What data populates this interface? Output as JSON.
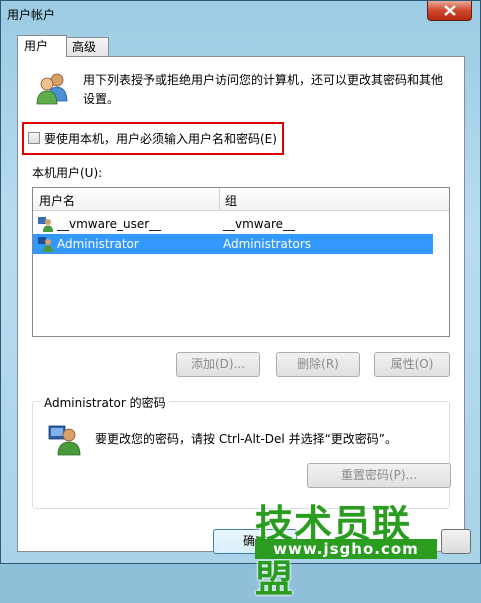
{
  "window": {
    "title": "用户帐户",
    "close_icon": "close-icon"
  },
  "tabs": [
    {
      "label": "用户",
      "active": true
    },
    {
      "label": "高级",
      "active": false
    }
  ],
  "intro": {
    "icon": "users-icon",
    "text": "用下列表授予或拒绝用户访问您的计算机，还可以更改其密码和其他设置。"
  },
  "require_login": {
    "label": "要使用本机，用户必须输入用户名和密码(E)",
    "checked": false,
    "highlight_color": "#e00000"
  },
  "users_list": {
    "caption": "本机用户(U):",
    "columns": [
      "用户名",
      "组"
    ],
    "rows": [
      {
        "user": "__vmware_user__",
        "group": "__vmware__",
        "selected": false
      },
      {
        "user": "Administrator",
        "group": "Administrators",
        "selected": true
      }
    ],
    "selection_color": "#3399ff"
  },
  "list_buttons": {
    "add": "添加(D)...",
    "delete": "删除(R)",
    "properties": "属性(O)"
  },
  "password_group": {
    "title": "Administrator 的密码",
    "text": "要更改您的密码，请按 Ctrl-Alt-Del 并选择“更改密码”。",
    "reset_button": "重置密码(P)..."
  },
  "footer": {
    "ok_label": "确定"
  },
  "watermark": {
    "main": "技术员联盟",
    "url": "www.jsgho.com",
    "color": "#2a9d21"
  }
}
